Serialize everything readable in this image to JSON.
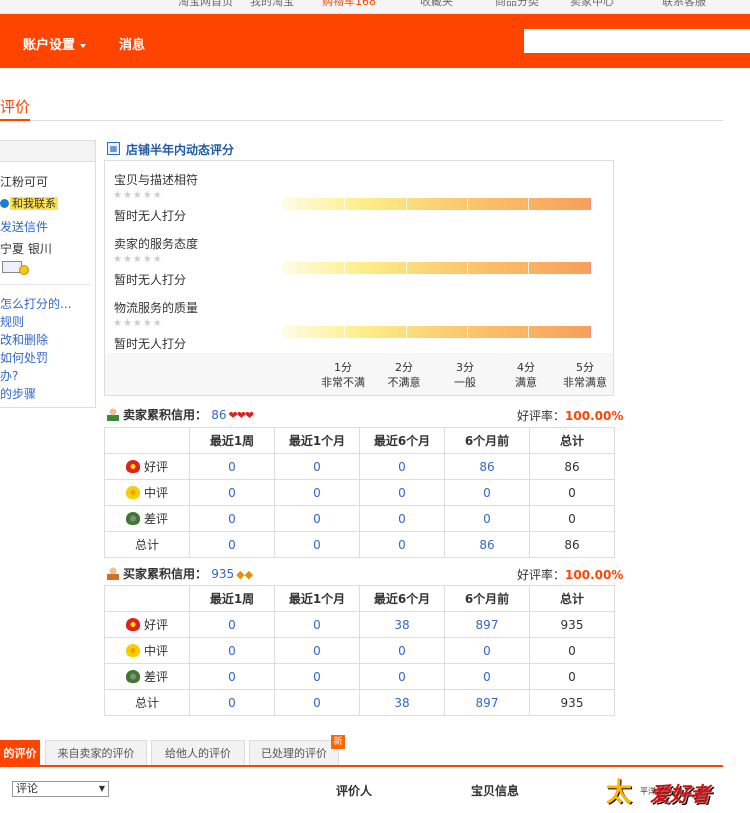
{
  "topbar": {
    "items": [
      "淘宝网首页",
      "我的淘宝",
      "购物车168",
      "收藏夹",
      "商品分类",
      "卖家中心",
      "联系客服"
    ]
  },
  "header": {
    "nav_account": "账户设置",
    "nav_message": "消息",
    "search_placeholder": ""
  },
  "page": {
    "title": "评价"
  },
  "sidebar": {
    "username": "江粉可可",
    "contact_label": "和我联系",
    "send_mail": "发送信件",
    "location": "宁夏  银川",
    "links": [
      "怎么打分的...",
      "规则",
      "改和删除",
      "如何处罚",
      "办?",
      "的步骤"
    ]
  },
  "dynamic_rating": {
    "title": "店铺半年内动态评分",
    "items": [
      {
        "label": "宝贝与描述相符",
        "stars": "★★★★★",
        "status": "暂时无人打分"
      },
      {
        "label": "卖家的服务态度",
        "stars": "★★★★★",
        "status": "暂时无人打分"
      },
      {
        "label": "物流服务的质量",
        "stars": "★★★★★",
        "status": "暂时无人打分"
      }
    ],
    "scale": [
      {
        "score": "1分",
        "desc": "非常不满"
      },
      {
        "score": "2分",
        "desc": "不满意"
      },
      {
        "score": "3分",
        "desc": "一般"
      },
      {
        "score": "4分",
        "desc": "满意"
      },
      {
        "score": "5分",
        "desc": "非常满意"
      }
    ]
  },
  "seller_credit": {
    "label": "卖家累积信用：",
    "value": "86",
    "level_icons": "❤❤❤",
    "rate_label": "好评率：",
    "rate_value": "100.00%",
    "headers": [
      "",
      "最近1周",
      "最近1个月",
      "最近6个月",
      "6个月前",
      "总计"
    ],
    "rows": [
      {
        "type": "好评",
        "values": [
          "0",
          "0",
          "0",
          "86",
          "86"
        ]
      },
      {
        "type": "中评",
        "values": [
          "0",
          "0",
          "0",
          "0",
          "0"
        ]
      },
      {
        "type": "差评",
        "values": [
          "0",
          "0",
          "0",
          "0",
          "0"
        ]
      },
      {
        "type": "总计",
        "values": [
          "0",
          "0",
          "0",
          "86",
          "86"
        ]
      }
    ]
  },
  "buyer_credit": {
    "label": "买家累积信用：",
    "value": "935",
    "level_icons": "◆◆",
    "rate_label": "好评率：",
    "rate_value": "100.00%",
    "headers": [
      "",
      "最近1周",
      "最近1个月",
      "最近6个月",
      "6个月前",
      "总计"
    ],
    "rows": [
      {
        "type": "好评",
        "values": [
          "0",
          "0",
          "38",
          "897",
          "935"
        ]
      },
      {
        "type": "中评",
        "values": [
          "0",
          "0",
          "0",
          "0",
          "0"
        ]
      },
      {
        "type": "差评",
        "values": [
          "0",
          "0",
          "0",
          "0",
          "0"
        ]
      },
      {
        "type": "总计",
        "values": [
          "0",
          "0",
          "38",
          "897",
          "935"
        ]
      }
    ]
  },
  "tabs": {
    "items": [
      "的评价",
      "来自卖家的评价",
      "给他人的评价",
      "已处理的评价"
    ],
    "new_badge": "新"
  },
  "list_header": {
    "select_value": "评论",
    "col_rater": "评价人",
    "col_item": "宝贝信息"
  },
  "watermark": {
    "text": "太平洋爱好者"
  }
}
